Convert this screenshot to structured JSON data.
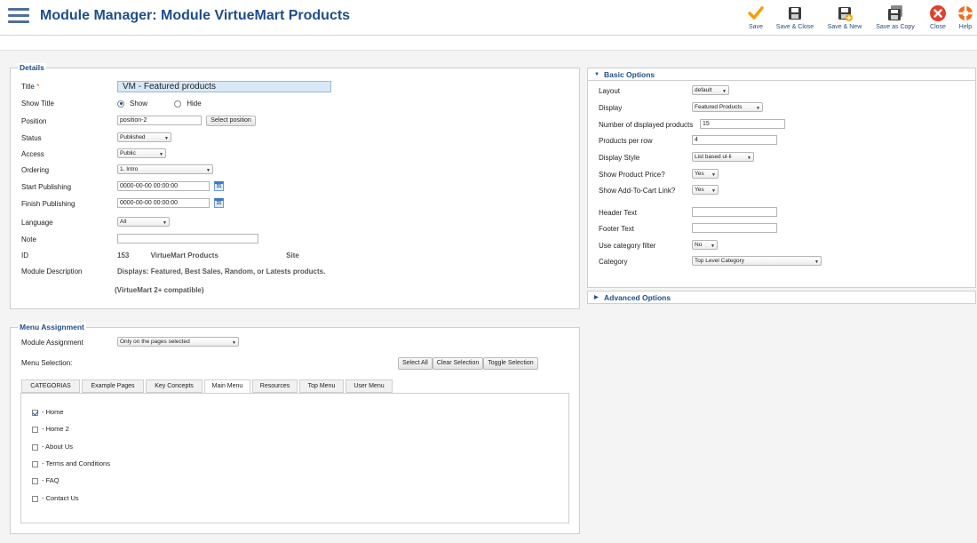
{
  "header": {
    "title": "Module Manager: Module VirtueMart Products",
    "toolbar": [
      {
        "label": "Save",
        "icon": "check-icon"
      },
      {
        "label": "Save & Close",
        "icon": "floppy-disk-icon"
      },
      {
        "label": "Save & New",
        "icon": "floppy-disk-plus-icon"
      },
      {
        "label": "Save as Copy",
        "icon": "floppy-disk-copy-icon"
      },
      {
        "label": "Close",
        "icon": "close-icon"
      },
      {
        "label": "Help",
        "icon": "help-lifebuoy-icon"
      }
    ]
  },
  "details": {
    "legend": "Details",
    "title_label": "Title",
    "title_required": "*",
    "title_value": "VM - Featured products",
    "show_title_label": "Show Title",
    "show_title_show": "Show",
    "show_title_hide": "Hide",
    "position_label": "Position",
    "position_value": "position-2",
    "select_position_button": "Select position",
    "status_label": "Status",
    "status_value": "Published",
    "access_label": "Access",
    "access_value": "Public",
    "ordering_label": "Ordering",
    "ordering_value": "1. Intro",
    "start_publishing_label": "Start Publishing",
    "start_publishing_value": "0000-00-00 00:00:00",
    "finish_publishing_label": "Finish Publishing",
    "finish_publishing_value": "0000-00-00 00:00:00",
    "language_label": "Language",
    "language_value": "All",
    "note_label": "Note",
    "note_value": "",
    "id_label": "ID",
    "id_value": "153",
    "module_name": "VirtueMart Products",
    "module_site": "Site",
    "description_label": "Module Description",
    "description_text": "Displays: Featured, Best Sales, Random, or Latests products.",
    "description_compat": "(VirtueMart 2+ compatible)"
  },
  "basic_options": {
    "heading": "Basic Options",
    "layout_label": "Layout",
    "layout_value": "default",
    "display_label": "Display",
    "display_value": "Featured Products",
    "num_products_label": "Number of displayed products",
    "num_products_value": "15",
    "per_row_label": "Products per row",
    "per_row_value": "4",
    "display_style_label": "Display Style",
    "display_style_value": "List based ul-li",
    "show_price_label": "Show Product Price?",
    "show_price_value": "Yes",
    "show_cart_label": "Show Add-To-Cart Link?",
    "show_cart_value": "Yes",
    "header_text_label": "Header Text",
    "header_text_value": "",
    "footer_text_label": "Footer Text",
    "footer_text_value": "",
    "category_filter_label": "Use category filter",
    "category_filter_value": "No",
    "category_label": "Category",
    "category_value": "Top Level Category"
  },
  "advanced_options": {
    "heading": "Advanced Options"
  },
  "menu_assignment": {
    "legend": "Menu Assignment",
    "module_assignment_label": "Module Assignment",
    "module_assignment_value": "Only on the pages selected",
    "menu_selection_label": "Menu Selection:",
    "select_all": "Select All",
    "clear_selection": "Clear Selection",
    "toggle_selection": "Toggle Selection",
    "tabs": [
      {
        "label": "CATEGORIAS"
      },
      {
        "label": "Example Pages"
      },
      {
        "label": "Key Concepts"
      },
      {
        "label": "Main Menu"
      },
      {
        "label": "Resources"
      },
      {
        "label": "Top Menu"
      },
      {
        "label": "User Menu"
      }
    ],
    "active_tab": "Main Menu",
    "items": [
      {
        "label": "- Home",
        "checked": true
      },
      {
        "label": "- Home 2",
        "checked": false
      },
      {
        "label": "- About Us",
        "checked": false
      },
      {
        "label": "- Terms and Conditions",
        "checked": false
      },
      {
        "label": "- FAQ",
        "checked": false
      },
      {
        "label": "- Contact Us",
        "checked": false
      }
    ]
  },
  "colors": {
    "accent": "#1f4e87",
    "save_check": "#f2a007",
    "close_red": "#e0402c",
    "help_orange": "#f26a1b"
  }
}
